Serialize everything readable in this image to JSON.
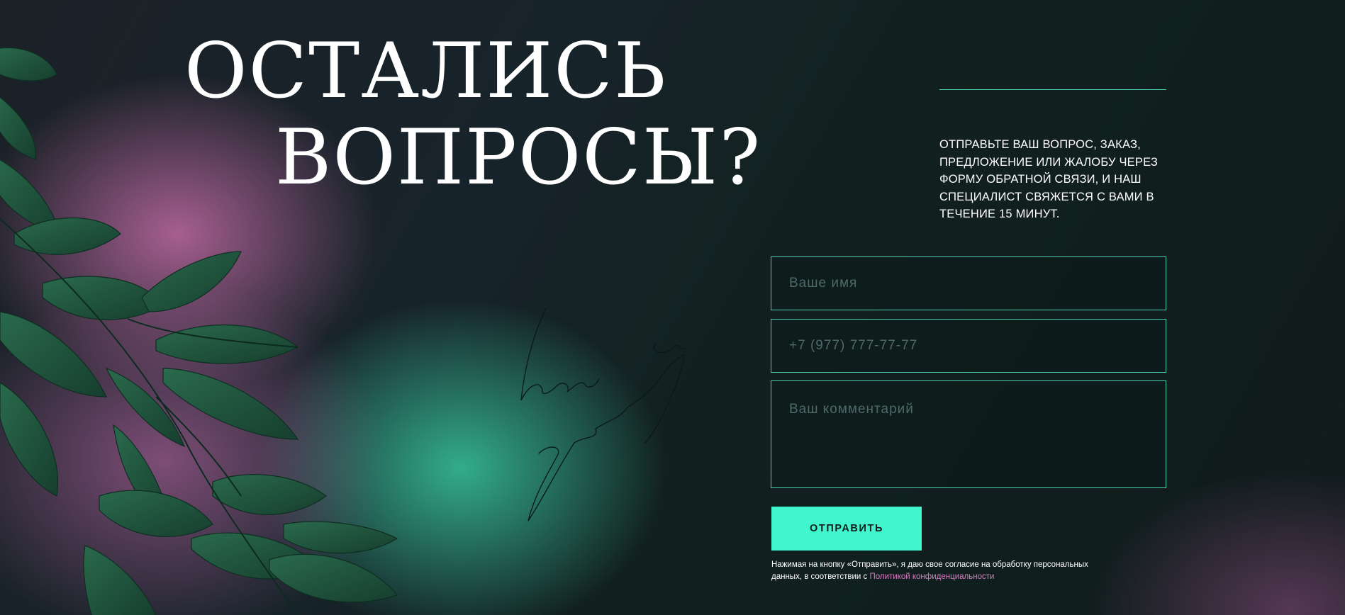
{
  "hero": {
    "title_line1": "ОСТАЛИСЬ",
    "title_line2": "ВОПРОСЫ?",
    "script_text": "have any questions"
  },
  "info": {
    "text": "ОТПРАВЬТЕ ВАШ ВОПРОС, ЗАКАЗ, ПРЕДЛОЖЕНИЕ ИЛИ ЖАЛОБУ ЧЕРЕЗ ФОРМУ ОБРАТНОЙ СВЯЗИ, И НАШ СПЕЦИАЛИСТ СВЯЖЕТСЯ С ВАМИ В ТЕЧЕНИЕ 15 МИНУТ."
  },
  "form": {
    "name_placeholder": "Ваше имя",
    "name_value": "",
    "phone_placeholder": "+7 (977) 777-77-77",
    "phone_value": "",
    "comment_placeholder": "Ваш комментарий",
    "comment_value": "",
    "submit_label": "ОТПРАВИТЬ",
    "consent_text": "Нажимая на кнопку «Отправить», я даю свое согласие на обработку персональных данных, в соответствии с ",
    "privacy_link": "Политикой конфиденциальности"
  },
  "colors": {
    "accent": "#41f5cc",
    "border": "#4fd1b4",
    "link": "#d57dc0",
    "background": "#0f1d1e"
  },
  "icons": [
    "leaf-decoration",
    "handwritten-script"
  ]
}
